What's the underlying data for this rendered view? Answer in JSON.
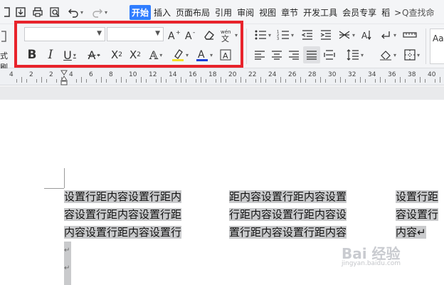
{
  "quick_access": {
    "icons": [
      "save-as-icon",
      "print-icon",
      "print-preview-icon",
      "undo-icon",
      "redo-icon"
    ]
  },
  "menu": {
    "tabs": [
      "开始",
      "插入",
      "页面布局",
      "引用",
      "审阅",
      "视图",
      "章节",
      "开发工具",
      "会员专享",
      "稻"
    ],
    "active": "开始",
    "more_glyph": ">"
  },
  "search": {
    "label": "Q查找命"
  },
  "ribbon": {
    "format_painter_label": "式刷",
    "font_name": "",
    "font_size": "",
    "font_color_hex": "#1a3fd9",
    "highlight_color_hex": "#f5e12a",
    "style_preview": "Aa"
  },
  "ruler": {
    "numbers": [
      "4",
      "2",
      "2",
      "4",
      "6",
      "8",
      "10",
      "12",
      "14",
      "16",
      "18",
      "20",
      "22",
      "24",
      "26",
      "28",
      "30",
      "32",
      "34",
      "36",
      "38",
      "40"
    ]
  },
  "document": {
    "columns": [
      [
        "设置行距内容设置行距内",
        "容设置行距内容设置行距",
        "内容设置行距内容设置行"
      ],
      [
        "距内容设置行距内容设置",
        "行距内容设置行距内容设",
        "置行距内容设置行距内容"
      ],
      [
        "设置行距",
        "容设置行",
        "内容↵"
      ]
    ],
    "para_mark": "↵"
  },
  "watermark": {
    "brand": "Bai 经验",
    "url": "jingyan.baidu.com"
  }
}
